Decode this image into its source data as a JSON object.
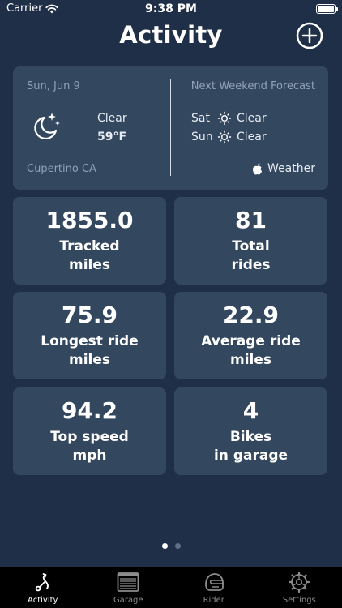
{
  "status_bar": {
    "carrier": "Carrier",
    "time": "9:38 PM"
  },
  "header": {
    "title": "Activity",
    "add_icon": "plus-circle-icon"
  },
  "weather": {
    "date": "Sun, Jun 9",
    "condition": "Clear",
    "temperature": "59°F",
    "location": "Cupertino CA",
    "forecast_title": "Next Weekend Forecast",
    "forecast": [
      {
        "day": "Sat",
        "condition": "Clear"
      },
      {
        "day": "Sun",
        "condition": "Clear"
      }
    ],
    "provider": "Weather"
  },
  "stats": [
    {
      "value": "1855.0",
      "line1": "Tracked",
      "line2": "miles"
    },
    {
      "value": "81",
      "line1": "Total",
      "line2": "rides"
    },
    {
      "value": "75.9",
      "line1": "Longest ride",
      "line2": "miles"
    },
    {
      "value": "22.9",
      "line1": "Average ride",
      "line2": "miles"
    },
    {
      "value": "94.2",
      "line1": "Top speed",
      "line2": "mph"
    },
    {
      "value": "4",
      "line1": "Bikes",
      "line2": "in garage"
    }
  ],
  "pager": {
    "pages": 2,
    "current": 1
  },
  "tabs": [
    {
      "label": "Activity",
      "icon": "route-icon",
      "active": true
    },
    {
      "label": "Garage",
      "icon": "garage-icon",
      "active": false
    },
    {
      "label": "Rider",
      "icon": "helmet-icon",
      "active": false
    },
    {
      "label": "Settings",
      "icon": "gear-icon",
      "active": false
    }
  ],
  "colors": {
    "background": "#1f2f47",
    "card": "#33475f",
    "muted_text": "#8fa2ba"
  }
}
